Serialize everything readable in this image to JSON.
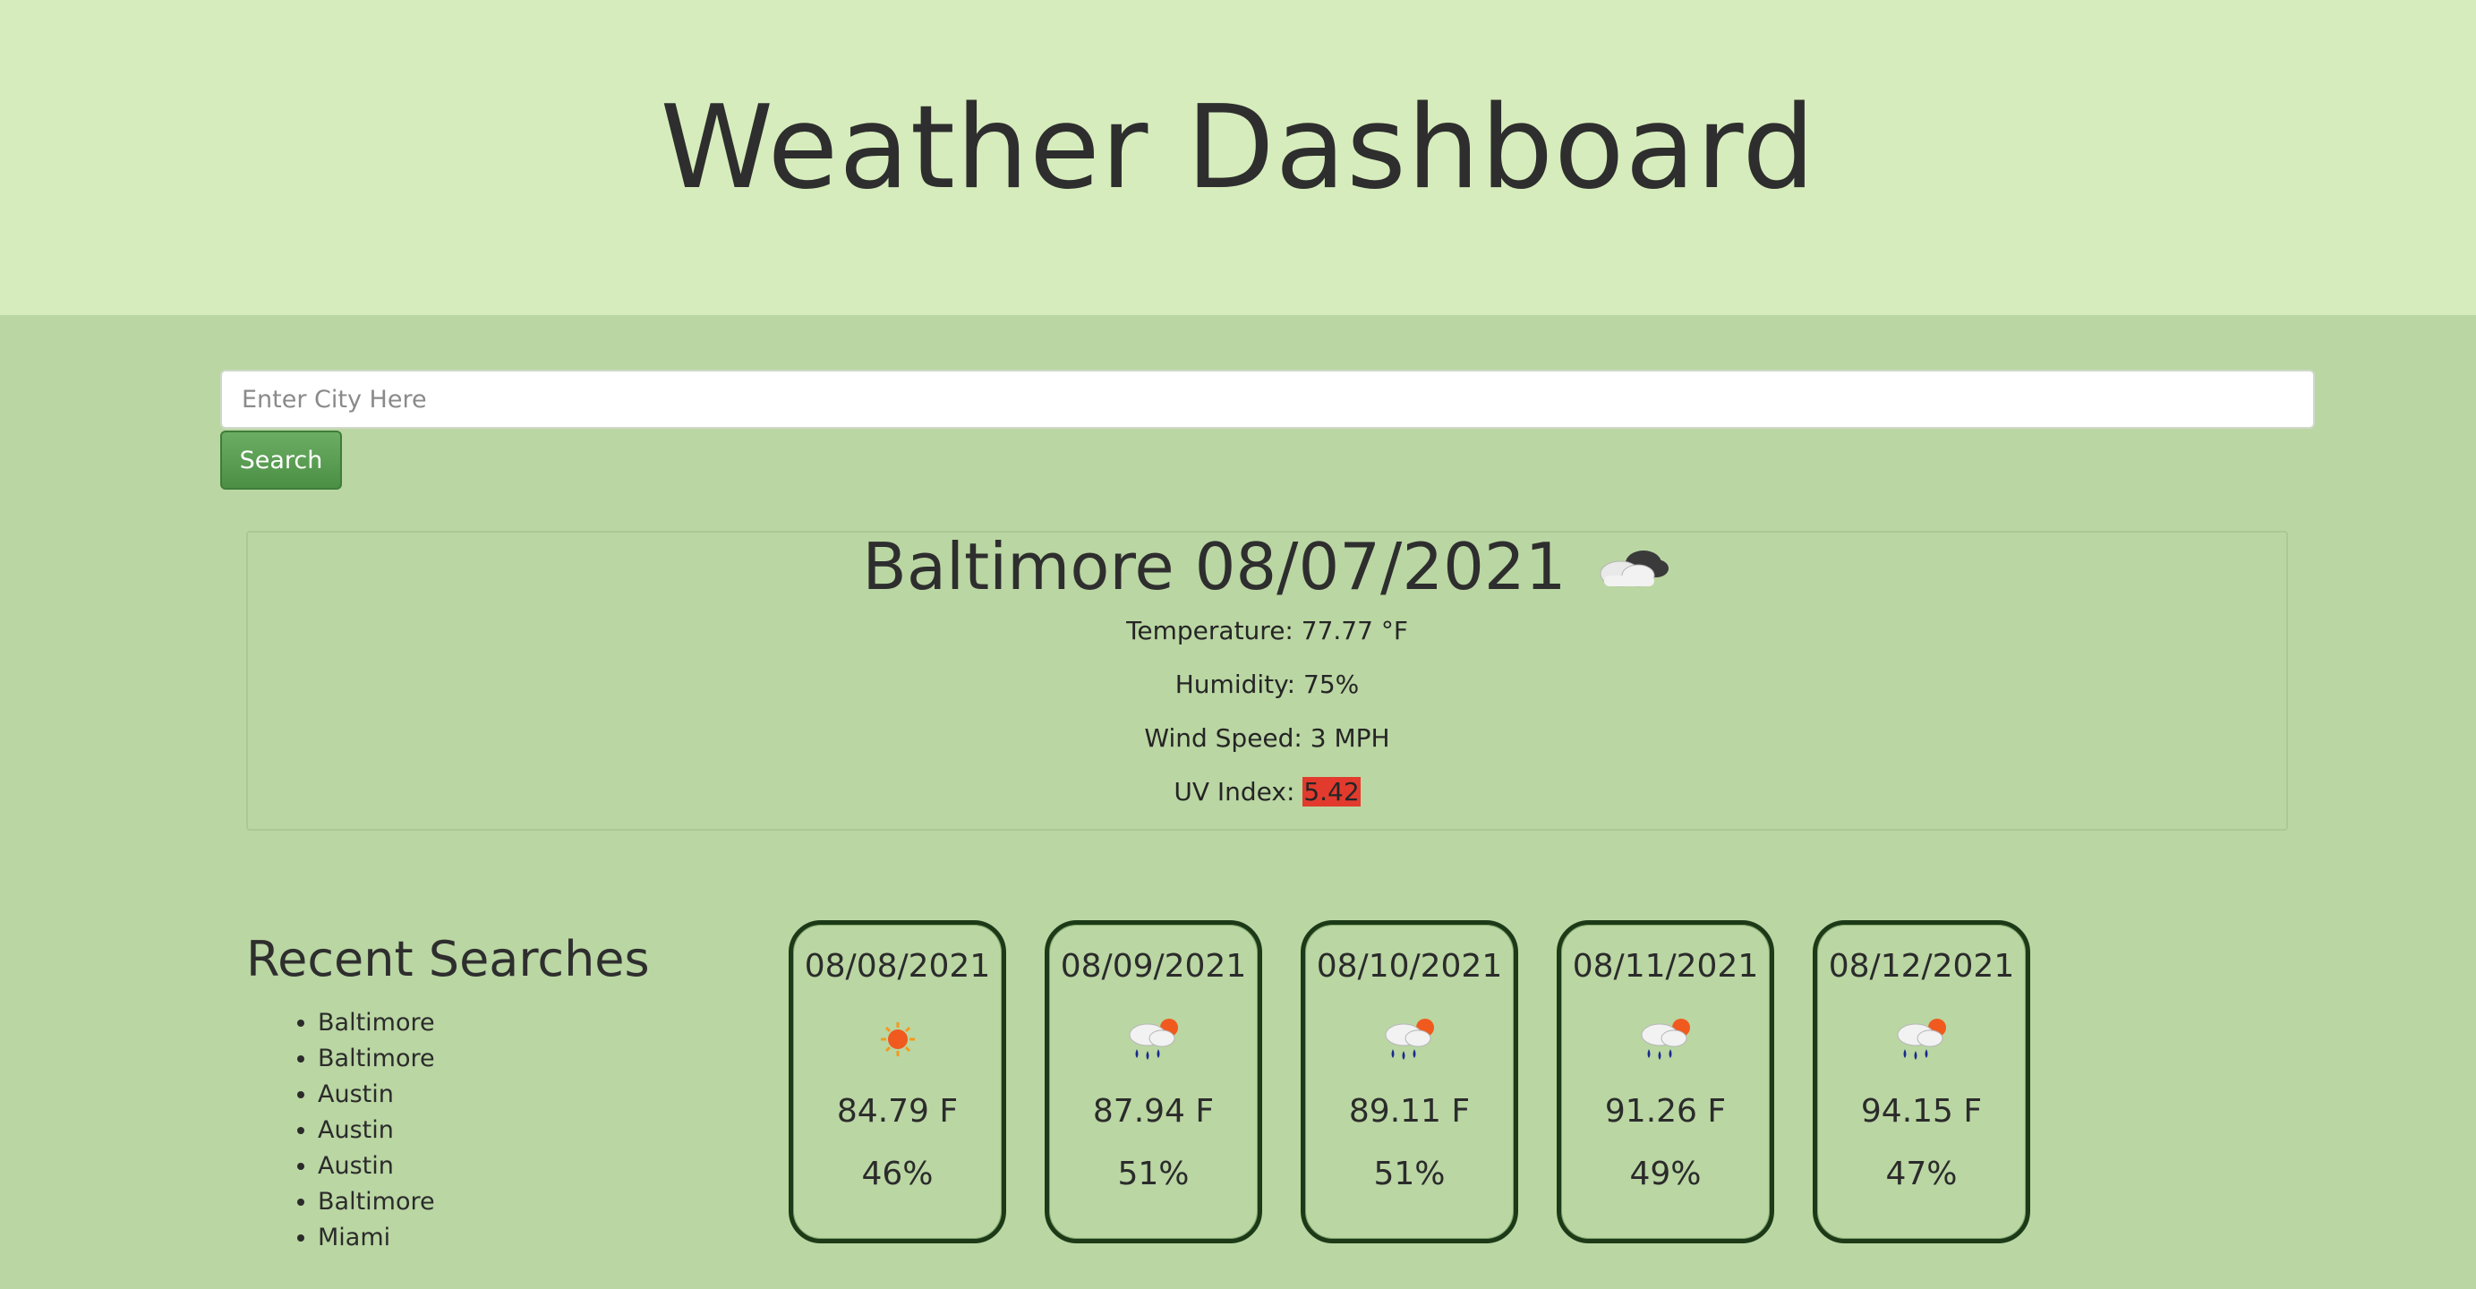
{
  "header": {
    "title": "Weather Dashboard"
  },
  "search": {
    "placeholder": "Enter City Here",
    "value": "",
    "button_label": "Search"
  },
  "current": {
    "title": "Baltimore 08/07/2021",
    "icon": "cloudy-icon",
    "temperature": "Temperature: 77.77 °F",
    "humidity": "Humidity: 75%",
    "wind": "Wind Speed: 3 MPH",
    "uv_label": "UV Index:",
    "uv_value": "5.42",
    "uv_color": "#e23b2e"
  },
  "recent": {
    "heading": "Recent Searches",
    "items": [
      "Baltimore",
      "Baltimore",
      "Austin",
      "Austin",
      "Austin",
      "Baltimore",
      "Miami"
    ]
  },
  "forecast": [
    {
      "date": "08/08/2021",
      "icon": "sun-icon",
      "temp": "84.79 F",
      "humidity": "46%"
    },
    {
      "date": "08/09/2021",
      "icon": "rain-sun-icon",
      "temp": "87.94 F",
      "humidity": "51%"
    },
    {
      "date": "08/10/2021",
      "icon": "rain-sun-icon",
      "temp": "89.11 F",
      "humidity": "51%"
    },
    {
      "date": "08/11/2021",
      "icon": "rain-sun-icon",
      "temp": "91.26 F",
      "humidity": "49%"
    },
    {
      "date": "08/12/2021",
      "icon": "rain-sun-icon",
      "temp": "94.15 F",
      "humidity": "47%"
    }
  ],
  "colors": {
    "header_bg": "#d6ecbc",
    "body_bg": "#bad6a3",
    "button": "#5a9e52",
    "card_border": "#1c3a17"
  }
}
